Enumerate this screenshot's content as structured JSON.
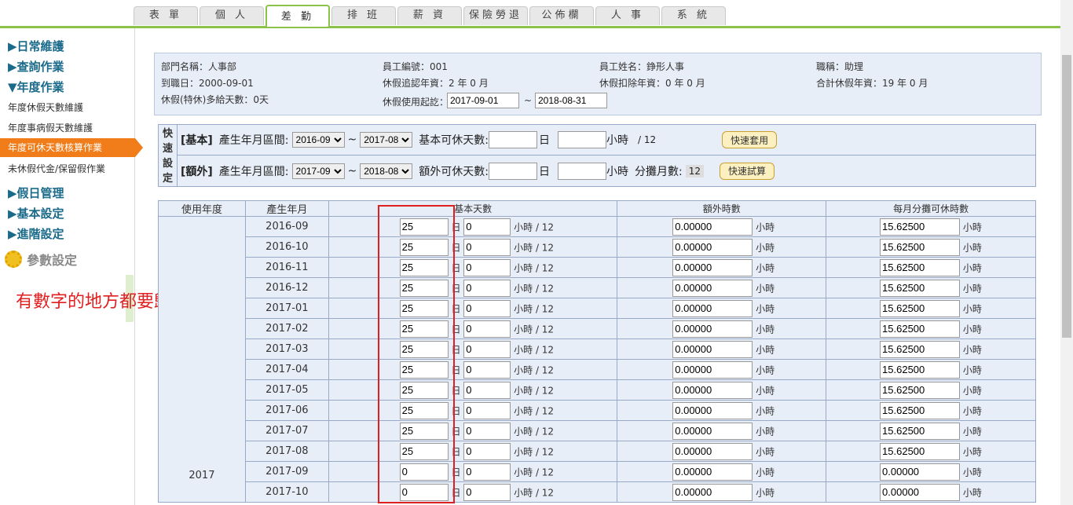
{
  "tabs": [
    "表 單",
    "個 人",
    "差 勤",
    "排 班",
    "薪 資",
    "保險勞退",
    "公佈欄",
    "人 事",
    "系 統"
  ],
  "active_tab": 2,
  "sidebar": {
    "daily": "▶日常維護",
    "query": "▶查詢作業",
    "annual": "▼年度作業",
    "items": [
      "年度休假天數維護",
      "年度事病假天數維護",
      "年度可休天數核算作業",
      "未休假代金/保留假作業"
    ],
    "active_item": 2,
    "holiday": "▶假日管理",
    "basic": "▶基本設定",
    "advanced": "▶進階設定",
    "param": "參數設定"
  },
  "note": "有數字的地方都要歸零",
  "info": {
    "dept": "部門名稱：人事部",
    "empno": "員工編號：001",
    "empname": "員工姓名：錚形人事",
    "title": "職稱：助理",
    "hire": "到職日：2000-09-01",
    "seniority": "休假追認年資：2 年 0 月",
    "deduct": "休假扣除年資：0 年 0 月",
    "total": "合計休假年資：19 年 0 月",
    "special": "休假(特休)多給天數：0天",
    "range_label": "休假使用起訖：",
    "range_start": "2017-09-01",
    "range_sep": "~",
    "range_end": "2018-08-31"
  },
  "quick": {
    "label": "快速設定",
    "basic_tag": "[基本]",
    "extra_tag": "[額外]",
    "period_label": "產生年月區間:",
    "basic_from": "2016-09",
    "basic_to": "2017-08",
    "extra_from": "2017-09",
    "extra_to": "2018-08",
    "tilde": "~",
    "basic_days_label": "基本可休天數:",
    "extra_days_label": "額外可休天數:",
    "day_unit": "日",
    "hour_unit": "小時",
    "per12": "/ 12",
    "split_label": "分攤月數:",
    "split_value": "12",
    "apply_btn": "快速套用",
    "calc_btn": "快速試算"
  },
  "grid": {
    "headers": [
      "使用年度",
      "產生年月",
      "基本天數",
      "額外時數",
      "每月分攤可休時數"
    ],
    "year": "2017",
    "day_unit": "日",
    "hour_unit": "小時",
    "per12": "小時 / 12",
    "rows": [
      {
        "ym": "2016-09",
        "days": "25",
        "hours": "0",
        "extra": "0.00000",
        "monthly": "15.62500"
      },
      {
        "ym": "2016-10",
        "days": "25",
        "hours": "0",
        "extra": "0.00000",
        "monthly": "15.62500"
      },
      {
        "ym": "2016-11",
        "days": "25",
        "hours": "0",
        "extra": "0.00000",
        "monthly": "15.62500"
      },
      {
        "ym": "2016-12",
        "days": "25",
        "hours": "0",
        "extra": "0.00000",
        "monthly": "15.62500"
      },
      {
        "ym": "2017-01",
        "days": "25",
        "hours": "0",
        "extra": "0.00000",
        "monthly": "15.62500"
      },
      {
        "ym": "2017-02",
        "days": "25",
        "hours": "0",
        "extra": "0.00000",
        "monthly": "15.62500"
      },
      {
        "ym": "2017-03",
        "days": "25",
        "hours": "0",
        "extra": "0.00000",
        "monthly": "15.62500"
      },
      {
        "ym": "2017-04",
        "days": "25",
        "hours": "0",
        "extra": "0.00000",
        "monthly": "15.62500"
      },
      {
        "ym": "2017-05",
        "days": "25",
        "hours": "0",
        "extra": "0.00000",
        "monthly": "15.62500"
      },
      {
        "ym": "2017-06",
        "days": "25",
        "hours": "0",
        "extra": "0.00000",
        "monthly": "15.62500"
      },
      {
        "ym": "2017-07",
        "days": "25",
        "hours": "0",
        "extra": "0.00000",
        "monthly": "15.62500"
      },
      {
        "ym": "2017-08",
        "days": "25",
        "hours": "0",
        "extra": "0.00000",
        "monthly": "15.62500"
      },
      {
        "ym": "2017-09",
        "days": "0",
        "hours": "0",
        "extra": "0.00000",
        "monthly": "0.00000"
      },
      {
        "ym": "2017-10",
        "days": "0",
        "hours": "0",
        "extra": "0.00000",
        "monthly": "0.00000"
      }
    ]
  }
}
